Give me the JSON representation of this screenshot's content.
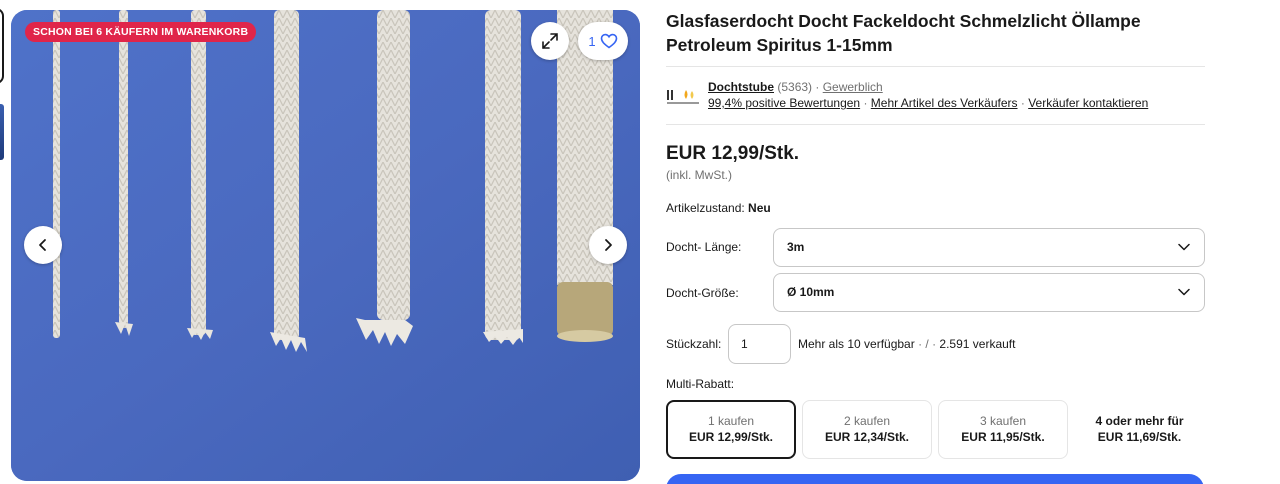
{
  "image": {
    "promo_badge": "SCHON BEI 6 KÄUFERN IM WARENKORB",
    "watch_count": "1",
    "icons": [
      "expand-icon",
      "heart-icon",
      "chevron-left-icon",
      "chevron-right-icon"
    ]
  },
  "product": {
    "title": "Glasfaserdocht Docht Fackeldocht Schmelzlicht Öllampe Petroleum Spiritus 1-15mm"
  },
  "seller": {
    "name": "Dochtstube",
    "feedback_count": "(5363)",
    "separator": " · ",
    "type": "Gewerblich",
    "positive": "99,4% positive Bewertungen",
    "more_items": "Mehr Artikel des Verkäufers",
    "contact": "Verkäufer kontaktieren"
  },
  "price": {
    "value": "EUR 12,99/Stk.",
    "vat_note": "(inkl. MwSt.)"
  },
  "condition": {
    "label": "Artikelzustand:",
    "value": "Neu"
  },
  "options": {
    "length_label": "Docht- Länge:",
    "length_value": "3m",
    "size_label": "Docht-Größe:",
    "size_value": "Ø 10mm"
  },
  "quantity": {
    "label": "Stückzahl:",
    "value": "1",
    "available": "Mehr als 10 verfügbar",
    "separator": " · / · ",
    "sold": "2.591 verkauft"
  },
  "multi_discount": {
    "label": "Multi-Rabatt:",
    "tiers": [
      {
        "qty": "1 kaufen",
        "price": "EUR 12,99/Stk."
      },
      {
        "qty": "2 kaufen",
        "price": "EUR 12,34/Stk."
      },
      {
        "qty": "3 kaufen",
        "price": "EUR 11,95/Stk."
      },
      {
        "qty": "4 oder mehr für",
        "price": "EUR 11,69/Stk."
      }
    ]
  },
  "colors": {
    "accent": "#3665f3",
    "promo": "#e0254a",
    "image_bg": "#4a6cc4"
  }
}
